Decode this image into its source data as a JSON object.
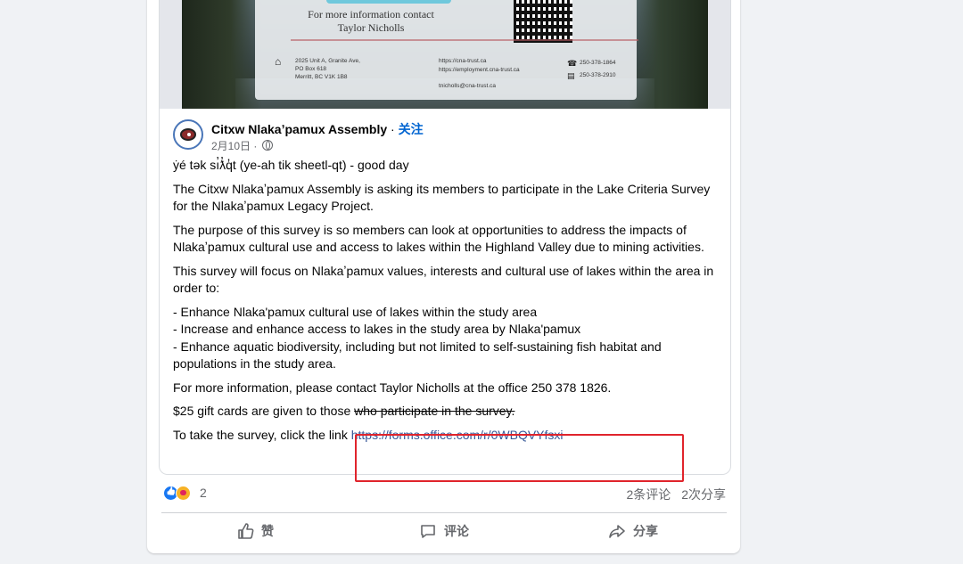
{
  "shared_image": {
    "contact_line1": "For more information contact",
    "contact_line2": "Taylor Nicholls",
    "address": "2025 Unit A, Granite Ave,\nPO Box 618\nMerritt, BC V1K 1B8",
    "url1": "https://cna-trust.ca",
    "url2": "https://employment.cna-trust.ca",
    "email": "tnicholls@cna-trust.ca",
    "phone": "250-378-1864",
    "fax": "250-378-2910"
  },
  "post": {
    "author": "Citxw Nlakaʼpamux Assembly",
    "separator": "·",
    "follow_label": "关注",
    "date": "2月10日",
    "separator2": "·",
    "paragraphs": [
      "ẏé tək sı̓ƛ̓q̓t (ye-ah tik sheetl-qt) - good day",
      "The Citxw Nlakaʼpamux Assembly is asking its members to participate in the Lake Criteria Survey for the Nlakaʼpamux Legacy Project.",
      "The purpose of this survey is so members can look at opportunities to address the impacts of Nlakaʼpamux cultural use and access to lakes within the Highland Valley due to mining activities.",
      "This survey will focus on Nlakaʼpamux values, interests and cultural use of lakes within the area in order to:",
      "- Enhance Nlaka'pamux cultural use of lakes within the study area",
      "- Increase and enhance access to lakes in the study area by Nlaka'pamux",
      "- Enhance aquatic biodiversity, including but not limited to self-sustaining fish habitat and populations in the study area.",
      "For more information, please contact Taylor Nicholls at the office 250 378 1826."
    ],
    "gift_prefix": "$25 gift cards are given to those ",
    "gift_struck": "who participate in the survey.",
    "survey_prefix": "To take the survey, click the link ",
    "survey_link": "https://forms.office.com/r/0WBQVYfsxi"
  },
  "engagement": {
    "reaction_count": "2",
    "comments": "2条评论",
    "shares": "2次分享"
  },
  "actions": {
    "like": "赞",
    "comment": "评论",
    "share": "分享"
  },
  "colors": {
    "link": "#385898",
    "follow": "#0064d1",
    "highlight_box": "#e0242c"
  }
}
